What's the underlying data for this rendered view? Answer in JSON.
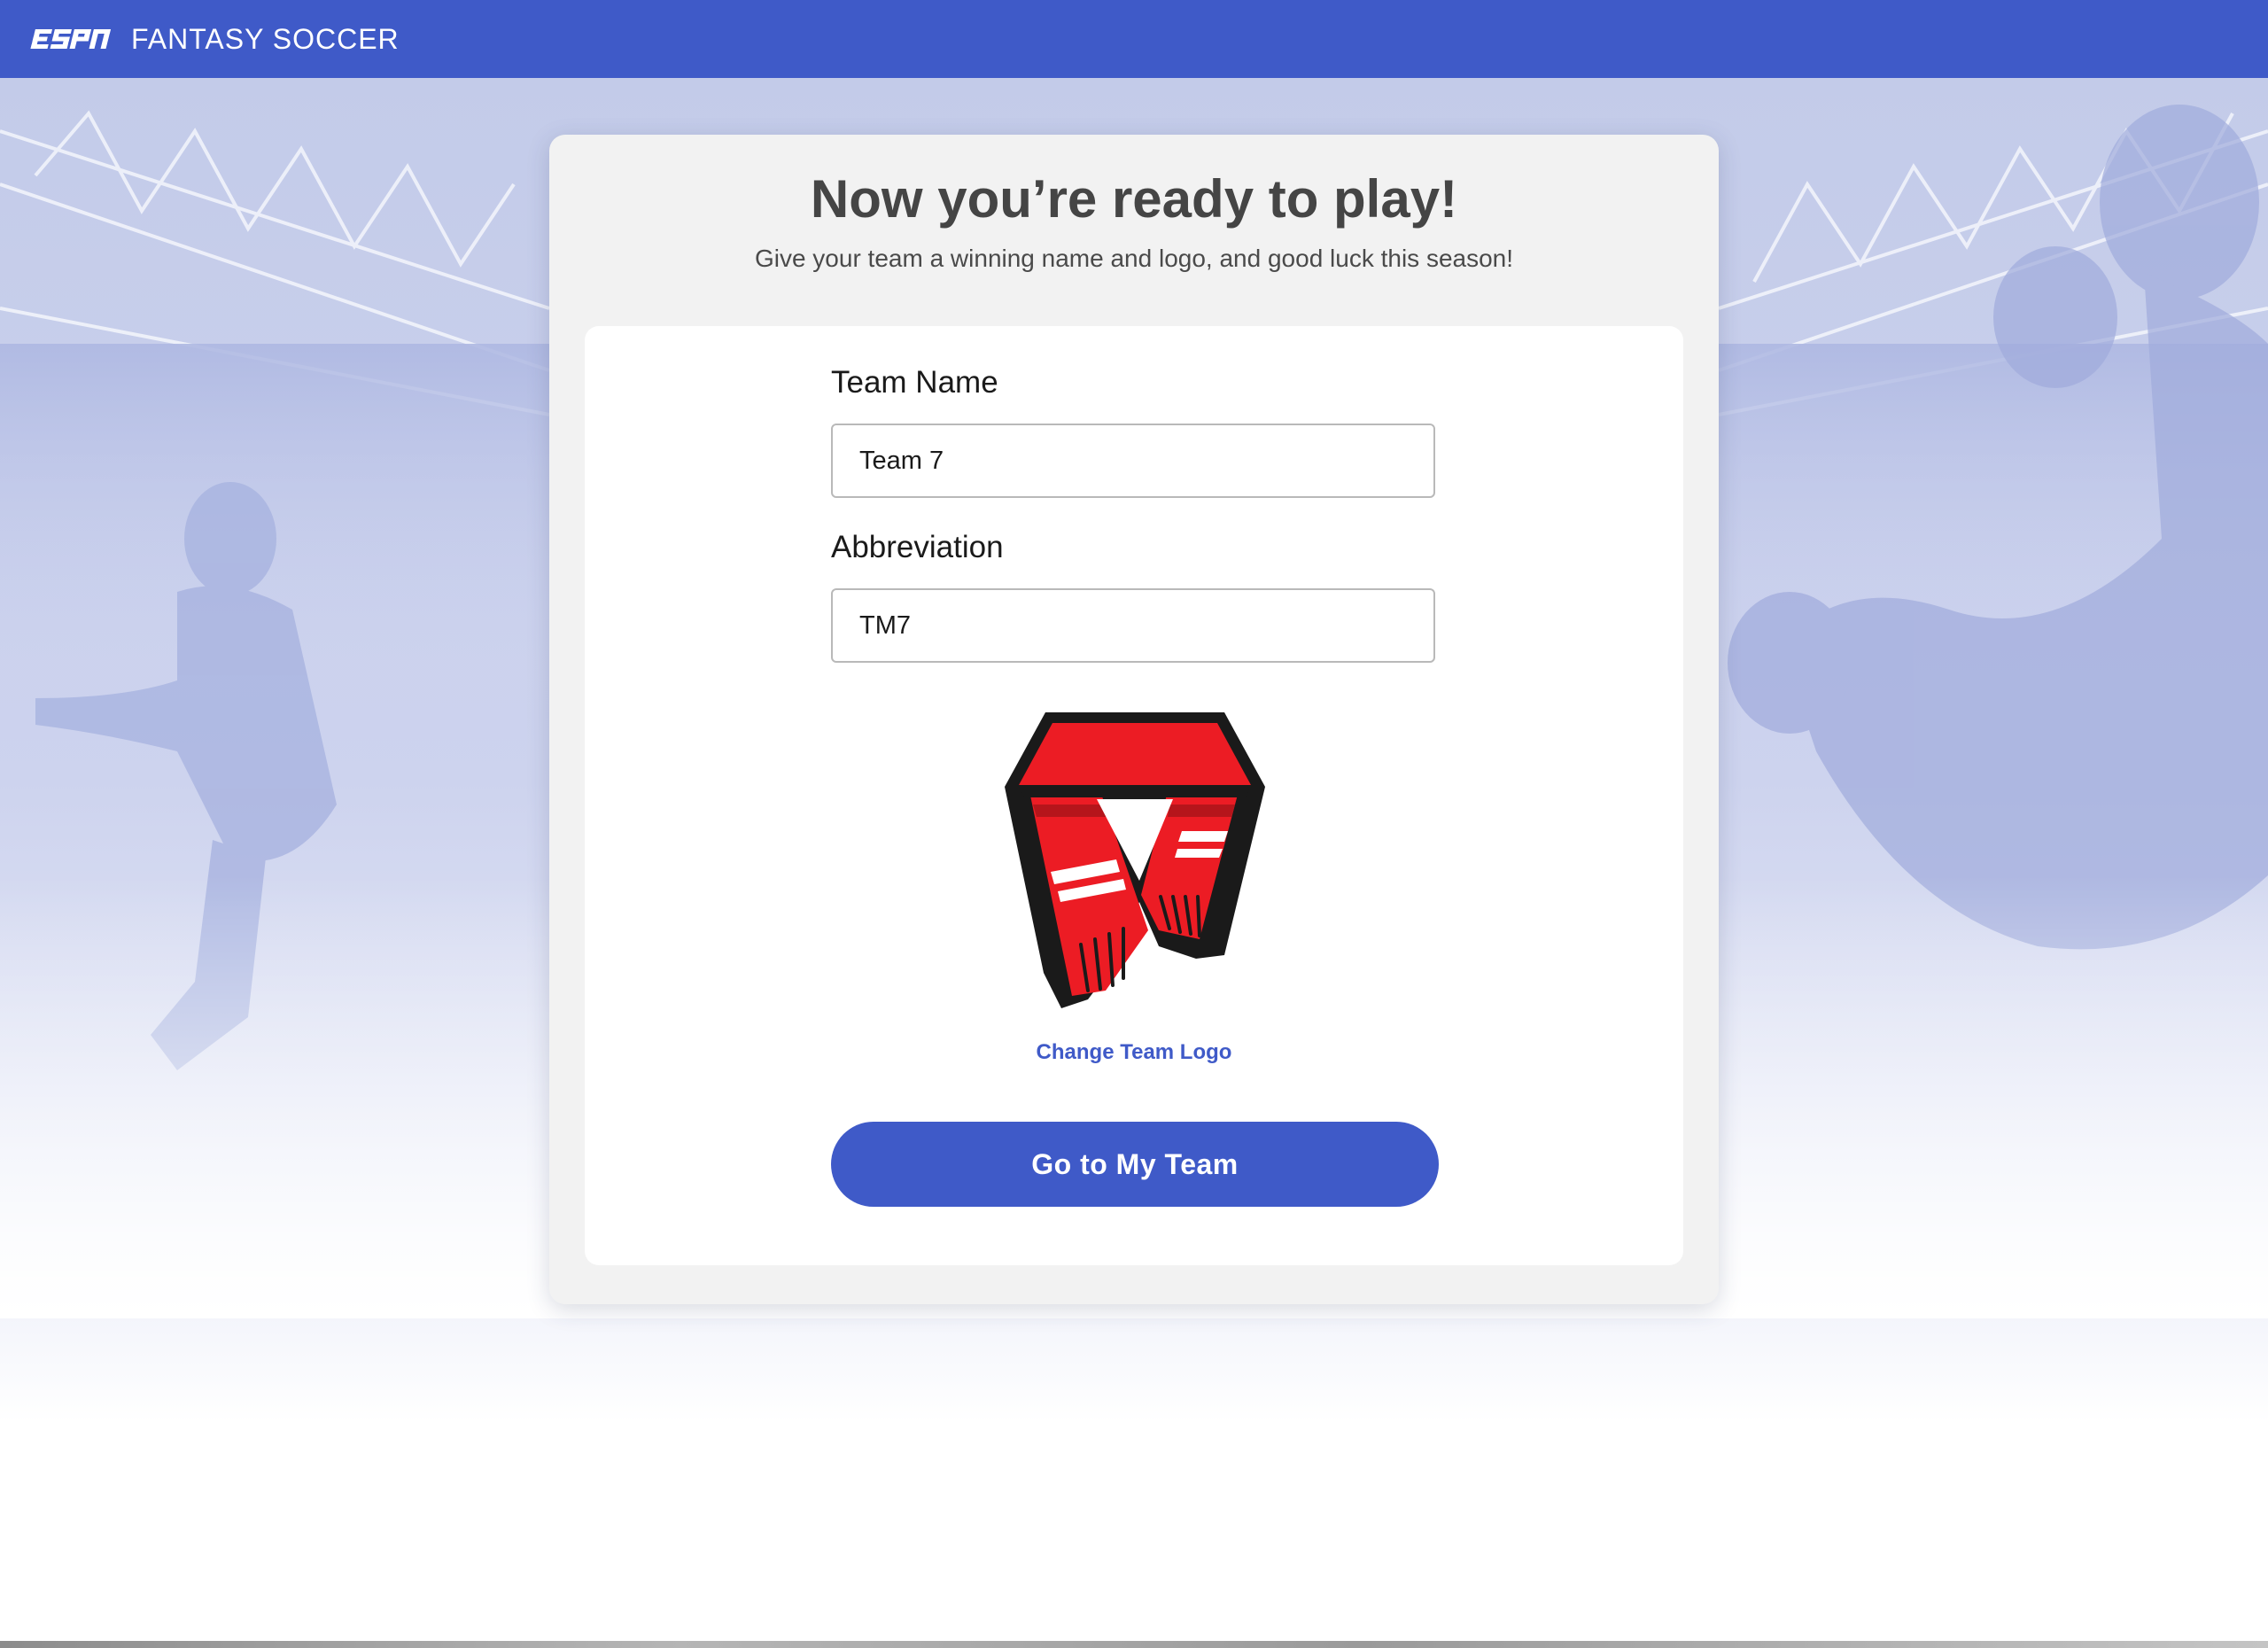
{
  "header": {
    "brand": "ESPN",
    "product": "FANTASY SOCCER"
  },
  "card": {
    "title": "Now you’re ready to play!",
    "subtitle": "Give your team a winning name and logo, and good luck this season!"
  },
  "form": {
    "team_name_label": "Team Name",
    "team_name_value": "Team 7",
    "abbreviation_label": "Abbreviation",
    "abbreviation_value": "TM7",
    "logo_icon": "scarf-icon",
    "change_logo_label": "Change Team Logo",
    "submit_label": "Go to My Team"
  },
  "colors": {
    "brand_blue": "#3f5ac8",
    "scarf_red": "#ec1c24",
    "card_bg": "#f2f2f2"
  }
}
